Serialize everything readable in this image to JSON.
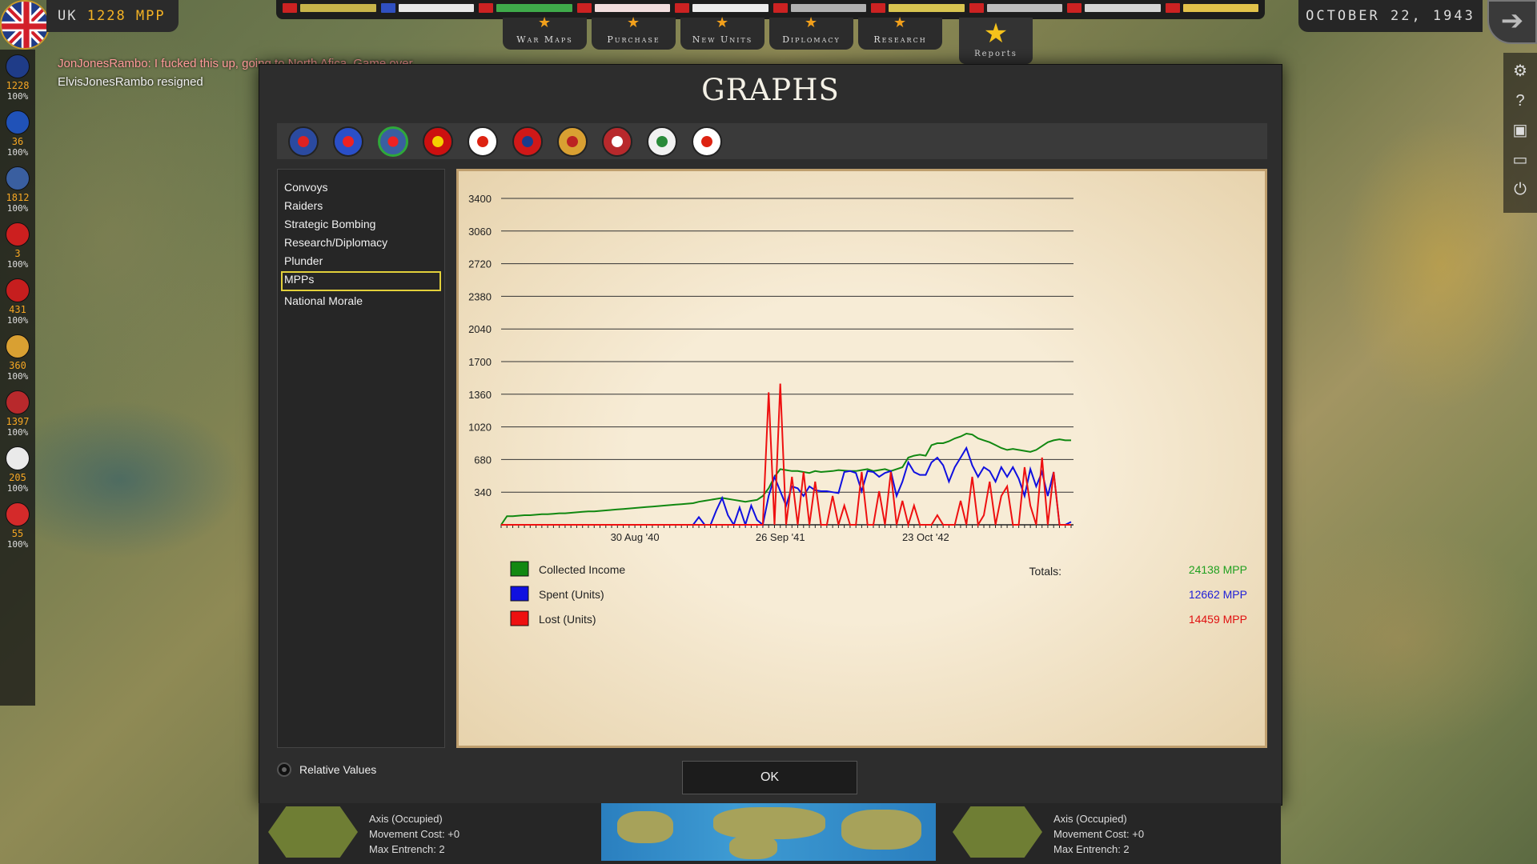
{
  "top": {
    "player_label": "UK",
    "player_mpp": "1228 MPP",
    "date": "OCTOBER 22, 1943",
    "flags": [
      {
        "name": "uk-flag",
        "color": "#c8b44a"
      },
      {
        "name": "france-flag",
        "color": "#e8e8e8"
      },
      {
        "name": "usa-flag",
        "color": "#3faa4a"
      },
      {
        "name": "ussr-flag",
        "color": "#f2dede"
      },
      {
        "name": "poland-flag",
        "color": "#ececec"
      },
      {
        "name": "china-flag",
        "color": "#b0b0b0"
      },
      {
        "name": "germany-flag",
        "color": "#d8c450"
      },
      {
        "name": "axis-flag",
        "color": "#bdbdbd"
      },
      {
        "name": "italy-flag",
        "color": "#d4d4d4"
      },
      {
        "name": "japan-flag",
        "color": "#e2c24a"
      }
    ],
    "buttons": [
      {
        "label": "War Maps"
      },
      {
        "label": "Purchase"
      },
      {
        "label": "New Units"
      },
      {
        "label": "Diplomacy"
      },
      {
        "label": "Research"
      }
    ],
    "reports_label": "Reports"
  },
  "chat": {
    "line1": "JonJonesRambo: I fucked this up, going to North Afica. Game over",
    "line2": "ElvisJonesRambo resigned"
  },
  "countries": [
    {
      "mpp": "1228",
      "pct": "100%",
      "color": "#1f3c88"
    },
    {
      "mpp": "36",
      "pct": "100%",
      "color": "#2052b8"
    },
    {
      "mpp": "1812",
      "pct": "100%",
      "color": "#3a5fa0"
    },
    {
      "mpp": "3",
      "pct": "100%",
      "color": "#cc1f1f"
    },
    {
      "mpp": "431",
      "pct": "100%",
      "color": "#c61e1e"
    },
    {
      "mpp": "360",
      "pct": "100%",
      "color": "#d9a032"
    },
    {
      "mpp": "1397",
      "pct": "100%",
      "color": "#b8292c"
    },
    {
      "mpp": "205",
      "pct": "100%",
      "color": "#eaeaea"
    },
    {
      "mpp": "55",
      "pct": "100%",
      "color": "#d42a2a"
    }
  ],
  "dialog": {
    "title": "GRAPHS",
    "flags": [
      {
        "name": "uk-flag",
        "color": "#2b4aa0",
        "accent": "#d22"
      },
      {
        "name": "france-flag",
        "color": "#2a4fc8",
        "accent": "#e22"
      },
      {
        "name": "usa-flag",
        "color": "#3a5fa0",
        "accent": "#e22",
        "selected": true
      },
      {
        "name": "ussr-flag",
        "color": "#cc1010",
        "accent": "#f5d000"
      },
      {
        "name": "poland-flag",
        "color": "#ffffff",
        "accent": "#d21"
      },
      {
        "name": "china-flag",
        "color": "#d01818",
        "accent": "#1a3c8c"
      },
      {
        "name": "germany-flag",
        "color": "#d9a032",
        "accent": "#b22"
      },
      {
        "name": "axis-flag",
        "color": "#b8292c",
        "accent": "#fff"
      },
      {
        "name": "italy-flag",
        "color": "#f1f1f1",
        "accent": "#2a8a3a"
      },
      {
        "name": "japan-flag",
        "color": "#ffffff",
        "accent": "#d21"
      }
    ],
    "menu": [
      {
        "label": "Convoys",
        "selected": false
      },
      {
        "label": "Raiders",
        "selected": false
      },
      {
        "label": "Strategic Bombing",
        "selected": false
      },
      {
        "label": "Research/Diplomacy",
        "selected": false
      },
      {
        "label": "Plunder",
        "selected": false
      },
      {
        "label": "MPPs",
        "selected": true
      },
      {
        "label": "National Morale",
        "selected": false
      }
    ],
    "relative_values": "Relative Values",
    "ok": "OK",
    "totals_label": "Totals:",
    "legend": [
      {
        "label": "Collected Income",
        "color": "#118811",
        "total": "24138 MPP"
      },
      {
        "label": "Spent (Units)",
        "color": "#1010e0",
        "total": "12662 MPP"
      },
      {
        "label": "Lost (Units)",
        "color": "#ee1010",
        "total": "14459 MPP"
      }
    ]
  },
  "chart_data": {
    "type": "line",
    "title": "",
    "xlabel": "",
    "ylabel": "",
    "ylim": [
      0,
      3400
    ],
    "yticks": [
      340,
      680,
      1020,
      1360,
      1700,
      2040,
      2380,
      2720,
      3060,
      3400
    ],
    "xtick_labels": [
      {
        "label": "30 Aug '40",
        "turn": 23
      },
      {
        "label": "26 Sep '41",
        "turn": 48
      },
      {
        "label": "23 Oct '42",
        "turn": 73
      }
    ],
    "n_turns": 98,
    "grid": true,
    "series": [
      {
        "name": "Collected Income",
        "color": "#118811",
        "values": [
          0,
          90,
          90,
          95,
          100,
          100,
          105,
          110,
          110,
          115,
          120,
          120,
          125,
          130,
          135,
          140,
          140,
          145,
          150,
          155,
          160,
          165,
          170,
          175,
          180,
          185,
          190,
          195,
          200,
          205,
          210,
          215,
          220,
          225,
          240,
          250,
          260,
          270,
          280,
          270,
          260,
          250,
          240,
          250,
          260,
          300,
          380,
          500,
          580,
          570,
          560,
          560,
          550,
          540,
          560,
          550,
          555,
          560,
          570,
          565,
          560,
          560,
          570,
          580,
          560,
          570,
          580,
          560,
          580,
          600,
          700,
          720,
          730,
          720,
          830,
          850,
          850,
          870,
          900,
          920,
          950,
          940,
          900,
          880,
          860,
          830,
          800,
          780,
          790,
          780,
          770,
          760,
          780,
          820,
          860,
          880,
          890,
          880,
          880
        ]
      },
      {
        "name": "Spent (Units)",
        "color": "#1010e0",
        "values": [
          0,
          0,
          0,
          0,
          0,
          0,
          0,
          0,
          0,
          0,
          0,
          0,
          0,
          0,
          0,
          0,
          0,
          0,
          0,
          0,
          0,
          0,
          0,
          0,
          0,
          0,
          0,
          0,
          0,
          0,
          0,
          0,
          0,
          0,
          80,
          0,
          0,
          150,
          280,
          100,
          0,
          180,
          0,
          200,
          50,
          0,
          300,
          500,
          350,
          200,
          400,
          380,
          300,
          400,
          360,
          350,
          350,
          340,
          330,
          550,
          560,
          540,
          350,
          560,
          550,
          500,
          540,
          560,
          300,
          450,
          650,
          550,
          520,
          520,
          650,
          700,
          620,
          450,
          600,
          700,
          800,
          620,
          500,
          600,
          560,
          450,
          600,
          500,
          600,
          480,
          300,
          580,
          400,
          550,
          300,
          550,
          0,
          0,
          30
        ]
      },
      {
        "name": "Lost (Units)",
        "color": "#ee1010",
        "values": [
          0,
          0,
          0,
          0,
          0,
          0,
          0,
          0,
          0,
          0,
          0,
          0,
          0,
          0,
          0,
          0,
          0,
          0,
          0,
          0,
          0,
          0,
          0,
          0,
          0,
          0,
          0,
          0,
          0,
          0,
          0,
          0,
          0,
          0,
          0,
          0,
          0,
          0,
          0,
          0,
          0,
          0,
          0,
          0,
          0,
          0,
          1380,
          0,
          1470,
          0,
          500,
          0,
          550,
          0,
          450,
          0,
          0,
          300,
          0,
          200,
          0,
          0,
          550,
          0,
          0,
          350,
          0,
          550,
          0,
          250,
          0,
          200,
          0,
          0,
          0,
          100,
          0,
          0,
          0,
          250,
          0,
          500,
          0,
          100,
          450,
          0,
          300,
          400,
          0,
          0,
          600,
          200,
          0,
          700,
          0,
          550,
          0,
          0,
          0
        ]
      }
    ]
  },
  "bottom": {
    "left_info": {
      "l1": "Axis (Occupied)",
      "l2": "Movement Cost: +0",
      "l3": "Max Entrench: 2"
    },
    "right_info": {
      "l1": "Axis (Occupied)",
      "l2": "Movement Cost: +0",
      "l3": "Max Entrench: 2"
    }
  }
}
